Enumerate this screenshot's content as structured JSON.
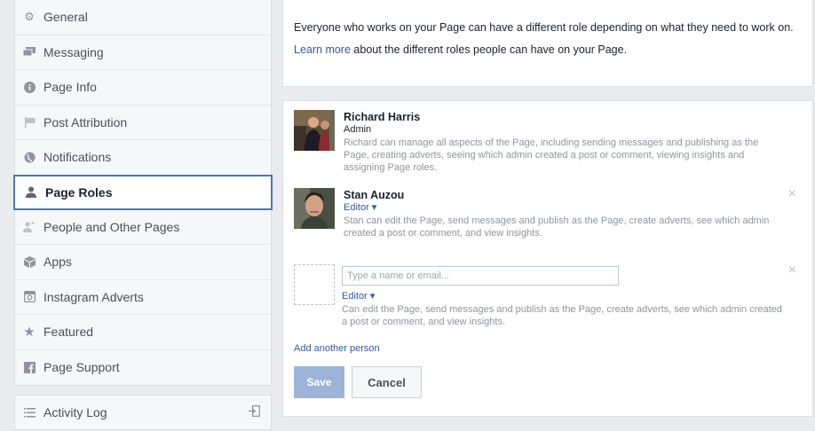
{
  "sidebar": {
    "items": [
      {
        "label": "General",
        "icon": "gear-icon"
      },
      {
        "label": "Messaging",
        "icon": "chat-icon"
      },
      {
        "label": "Page Info",
        "icon": "info-icon"
      },
      {
        "label": "Post Attribution",
        "icon": "flag-icon"
      },
      {
        "label": "Notifications",
        "icon": "globe-icon"
      },
      {
        "label": "Page Roles",
        "icon": "person-icon",
        "active": true
      },
      {
        "label": "People and Other Pages",
        "icon": "people-icon"
      },
      {
        "label": "Apps",
        "icon": "cube-icon"
      },
      {
        "label": "Instagram Adverts",
        "icon": "camera-icon"
      },
      {
        "label": "Featured",
        "icon": "star-icon"
      },
      {
        "label": "Page Support",
        "icon": "facebook-icon"
      }
    ],
    "activity_log": {
      "label": "Activity Log",
      "icon": "list-icon",
      "right_icon": "export-icon"
    }
  },
  "intro": {
    "text": "Everyone who works on your Page can have a different role depending on what they need to work on.",
    "learn_more_link": "Learn more",
    "learn_more_rest": " about the different roles people can have on your Page."
  },
  "people": [
    {
      "name": "Richard Harris",
      "role": "Admin",
      "description": "Richard can manage all aspects of the Page, including sending messages and publishing as the Page, creating adverts, seeing which admin created a post or comment, viewing insights and assigning Page roles."
    },
    {
      "name": "Stan Auzou",
      "role": "Editor ▾",
      "description": "Stan can edit the Page, send messages and publish as the Page, create adverts, see which admin created a post or comment, and view insights."
    }
  ],
  "new_person": {
    "placeholder": "Type a name or email...",
    "role": "Editor ▾",
    "description": "Can edit the Page, send messages and publish as the Page, create adverts, see which admin created a post or comment, and view insights."
  },
  "add_another": "Add another person",
  "buttons": {
    "save": "Save",
    "cancel": "Cancel"
  },
  "close_glyph": "×"
}
